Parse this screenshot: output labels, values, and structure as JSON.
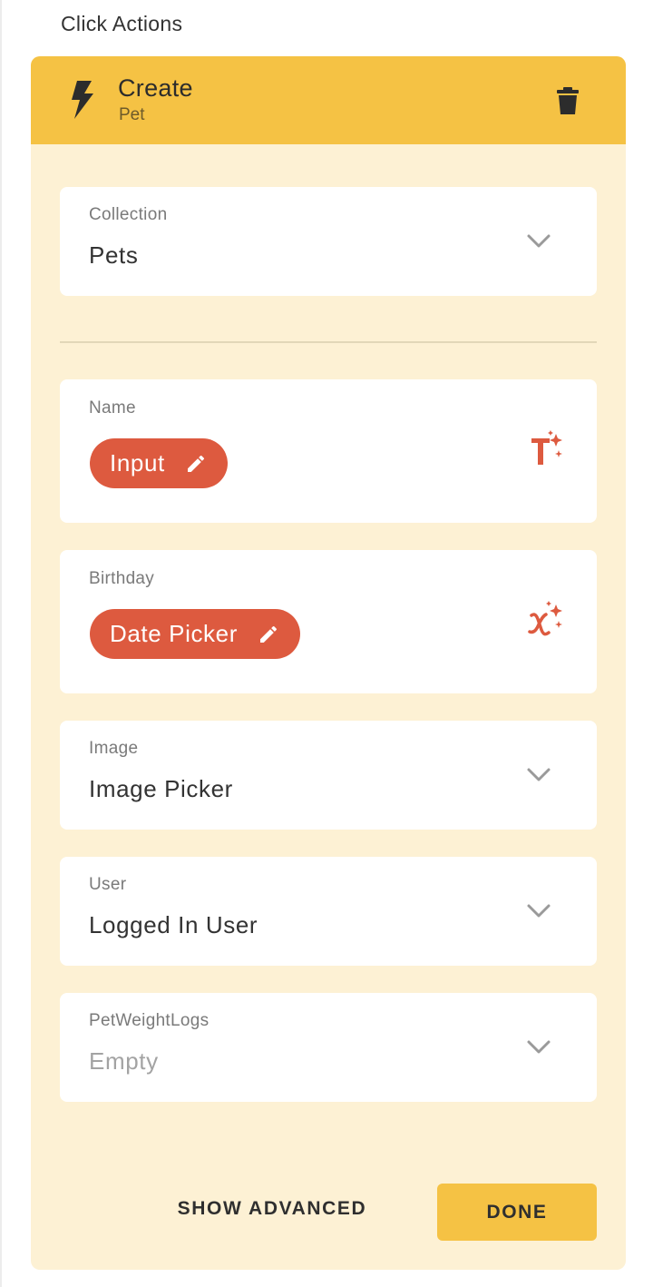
{
  "section": {
    "title": "Click Actions"
  },
  "action": {
    "title": "Create",
    "subtitle": "Pet",
    "icon": "lightning-bolt-icon",
    "delete_icon": "trash-icon"
  },
  "fields": {
    "collection": {
      "label": "Collection",
      "value": "Pets"
    },
    "name": {
      "label": "Name",
      "chip": "Input",
      "magic_icon": "magic-text-icon"
    },
    "birthday": {
      "label": "Birthday",
      "chip": "Date Picker",
      "magic_icon": "magic-variable-icon"
    },
    "image": {
      "label": "Image",
      "value": "Image Picker"
    },
    "user": {
      "label": "User",
      "value": "Logged In User"
    },
    "pet_weight_logs": {
      "label": "PetWeightLogs",
      "value": "Empty"
    }
  },
  "footer": {
    "show_advanced_label": "SHOW ADVANCED",
    "done_label": "DONE"
  },
  "colors": {
    "header_bg": "#f5c244",
    "panel_bg": "#fdf1d4",
    "chip_bg": "#dd5a3f",
    "accent_red": "#dd5a3f"
  }
}
